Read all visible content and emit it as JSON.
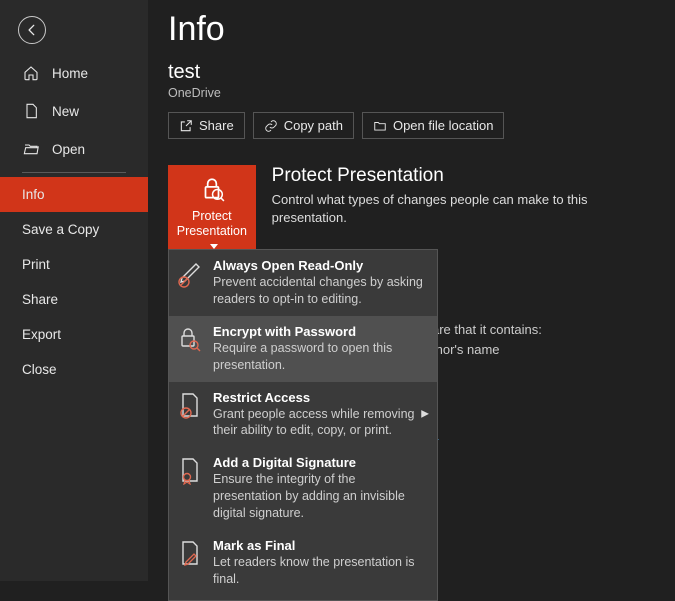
{
  "sidebar": {
    "items": [
      {
        "label": "Home"
      },
      {
        "label": "New"
      },
      {
        "label": "Open"
      },
      {
        "label": "Info"
      },
      {
        "label": "Save a Copy"
      },
      {
        "label": "Print"
      },
      {
        "label": "Share"
      },
      {
        "label": "Export"
      },
      {
        "label": "Close"
      }
    ]
  },
  "page": {
    "title": "Info",
    "doc_name": "test",
    "doc_location": "OneDrive"
  },
  "actions": {
    "share": "Share",
    "copy_path": "Copy path",
    "open_location": "Open file location"
  },
  "protect": {
    "button_label_line1": "Protect",
    "button_label_line2": "Presentation",
    "section_title": "Protect Presentation",
    "section_desc": "Control what types of changes people can make to this presentation."
  },
  "inspect_bg": {
    "line1_suffix": "are that it contains:",
    "line2_suffix": "thor's name",
    "link_suffix": "s"
  },
  "dropdown": [
    {
      "title": "Always Open Read-Only",
      "desc": "Prevent accidental changes by asking readers to opt-in to editing."
    },
    {
      "title": "Encrypt with Password",
      "desc": "Require a password to open this presentation."
    },
    {
      "title": "Restrict Access",
      "desc": "Grant people access while removing their ability to edit, copy, or print."
    },
    {
      "title": "Add a Digital Signature",
      "desc": "Ensure the integrity of the presentation by adding an invisible digital signature."
    },
    {
      "title": "Mark as Final",
      "desc": "Let readers know the presentation is final."
    }
  ]
}
